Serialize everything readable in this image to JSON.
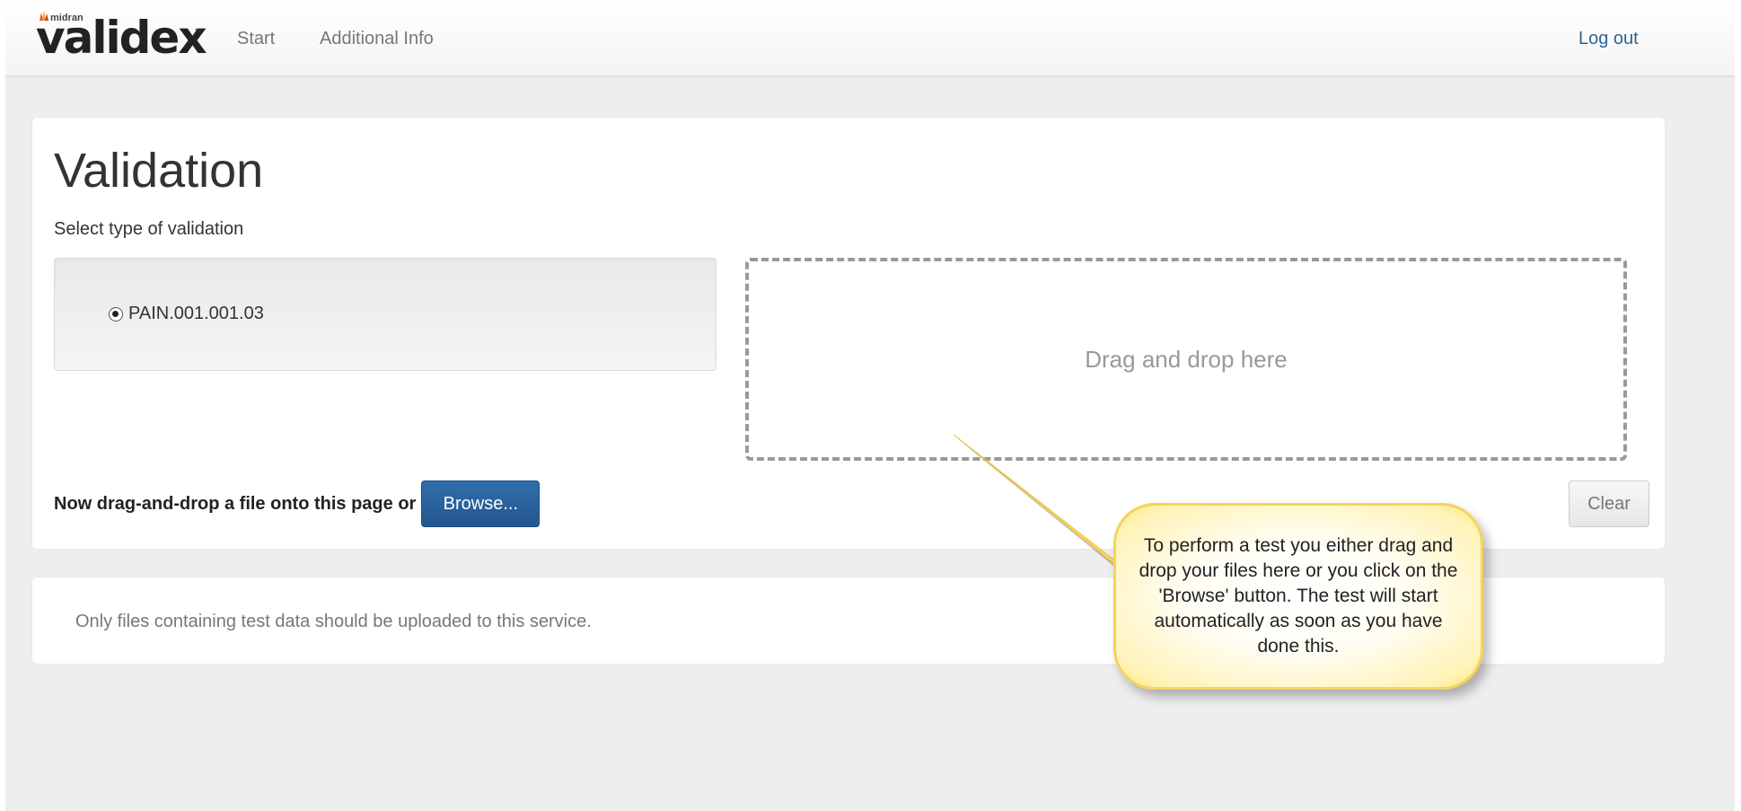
{
  "brand": {
    "company": "midran",
    "product": "validex",
    "trademark": "™"
  },
  "nav": {
    "start": "Start",
    "additional_info": "Additional Info",
    "logout": "Log out"
  },
  "validation": {
    "title": "Validation",
    "select_label": "Select type of validation",
    "options": [
      {
        "label": "PAIN.001.001.03",
        "selected": true
      }
    ],
    "dropzone_text": "Drag and drop here",
    "upload_prompt": "Now drag-and-drop a file onto this page or",
    "browse_label": "Browse...",
    "clear_label": "Clear"
  },
  "notice": {
    "text": "Only files containing test data should be uploaded to this service."
  },
  "callout": {
    "text": "To perform a test you either drag and drop your files here or you click on the 'Browse' button. The test will start automatically as soon as you have done this."
  },
  "colors": {
    "primary": "#2a6496",
    "callout_border": "#f4d35a",
    "background": "#eeeeee"
  }
}
